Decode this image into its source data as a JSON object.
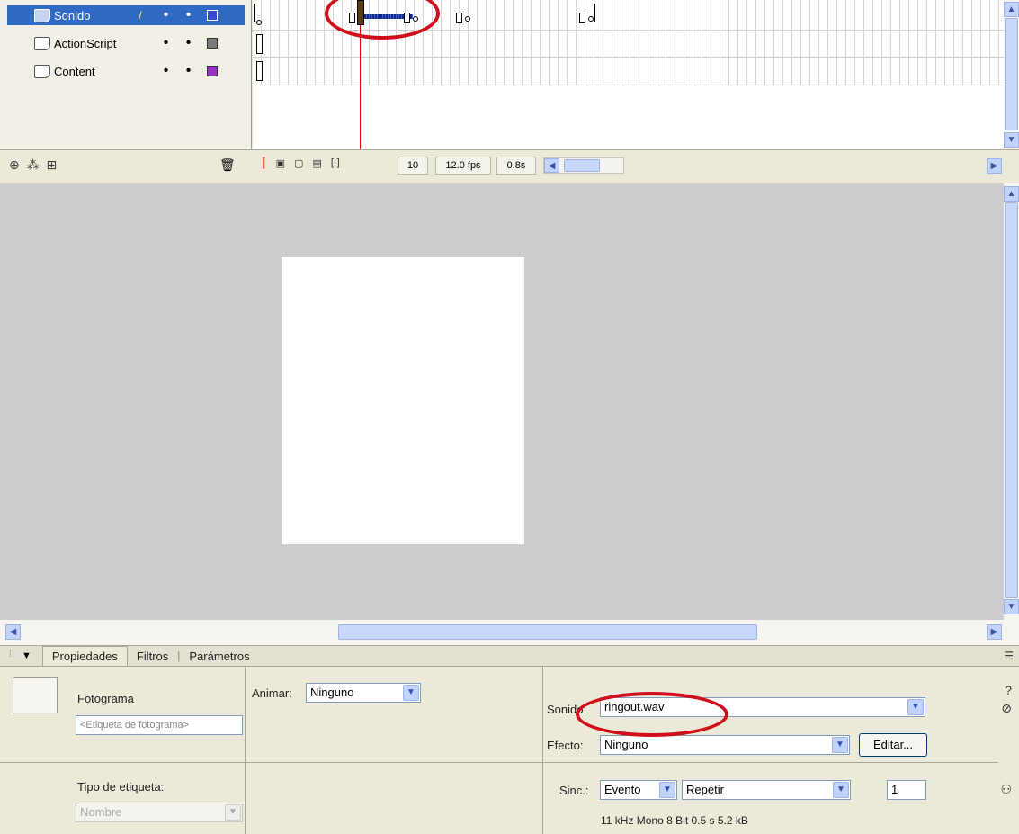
{
  "timeline": {
    "layers": [
      {
        "name": "Sonido",
        "selected": true,
        "color": "#3a4bd8",
        "pencil": "/"
      },
      {
        "name": "ActionScript",
        "selected": false,
        "color": "#7a7a7a",
        "pencil": ""
      },
      {
        "name": "Content",
        "selected": false,
        "color": "#9b30c8",
        "pencil": ""
      }
    ],
    "dot": "•",
    "footer": {
      "current_frame": "10",
      "frame_rate": "12.0 fps",
      "elapsed_time": "0.8s"
    }
  },
  "properties": {
    "tabs": [
      "Propiedades",
      "Filtros",
      "Parámetros"
    ],
    "frame_label": "Fotograma",
    "frame_label_placeholder": "<Etiqueta de fotograma>",
    "label_type_label": "Tipo de etiqueta:",
    "label_type_value": "Nombre",
    "tween_label": "Animar:",
    "tween_value": "Ninguno",
    "sound_label": "Sonido:",
    "sound_value": "ringout.wav",
    "effect_label": "Efecto:",
    "effect_value": "Ninguno",
    "edit_button": "Editar...",
    "sync_label": "Sinc.:",
    "sync_value": "Evento",
    "repeat_value": "Repetir",
    "repeat_count": "1",
    "sound_info": "11 kHz Mono 8 Bit 0.5 s 5.2 kB"
  },
  "colors": {
    "selection": "#316ac5",
    "stage_bg": "#cccccc",
    "annotation": "#d10f1a",
    "playhead_line": "#ee0000"
  }
}
